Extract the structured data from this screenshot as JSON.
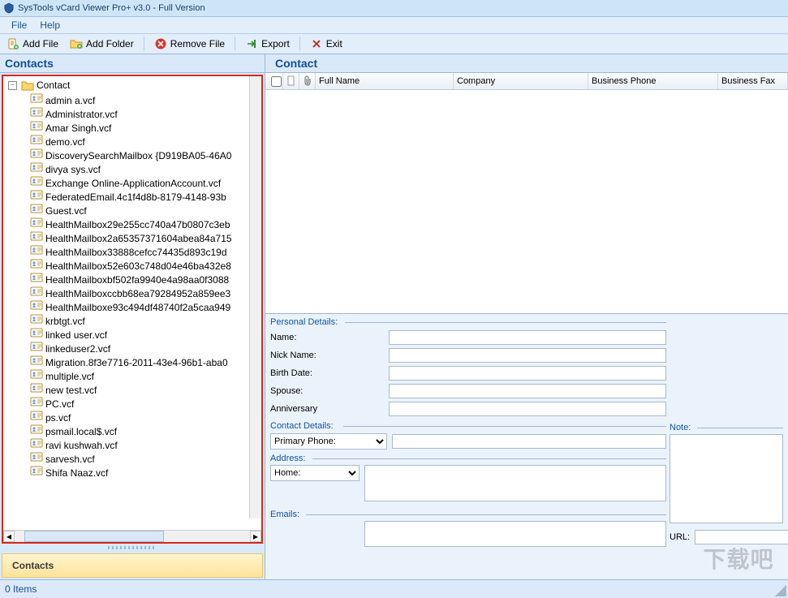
{
  "titlebar": {
    "text": "SysTools vCard Viewer Pro+ v3.0 - Full Version"
  },
  "menubar": {
    "file": "File",
    "help": "Help"
  },
  "toolbar": {
    "add_file": "Add File",
    "add_folder": "Add Folder",
    "remove_file": "Remove File",
    "export": "Export",
    "exit": "Exit"
  },
  "left": {
    "header": "Contacts",
    "root_label": "Contact",
    "items": [
      "admin a.vcf",
      "Administrator.vcf",
      "Amar Singh.vcf",
      "demo.vcf",
      "DiscoverySearchMailbox {D919BA05-46A0",
      "divya sys.vcf",
      "Exchange Online-ApplicationAccount.vcf",
      "FederatedEmail.4c1f4d8b-8179-4148-93b",
      "Guest.vcf",
      "HealthMailbox29e255cc740a47b0807c3eb",
      "HealthMailbox2a65357371604abea84a715",
      "HealthMailbox33888cefcc74435d893c19d",
      "HealthMailbox52e603c748d04e46ba432e8",
      "HealthMailboxbf502fa9940e4a98aa0f3088",
      "HealthMailboxccbb68ea79284952a859ee3",
      "HealthMailboxe93c494df48740f2a5caa949",
      "krbtgt.vcf",
      "linked user.vcf",
      "linkeduser2.vcf",
      "Migration.8f3e7716-2011-43e4-96b1-aba0",
      "multiple.vcf",
      "new test.vcf",
      "PC.vcf",
      "ps.vcf",
      "psmail.local$.vcf",
      "ravi kushwah.vcf",
      "sarvesh.vcf",
      "Shifa Naaz.vcf"
    ],
    "nav_label": "Contacts"
  },
  "right": {
    "header": "Contact",
    "columns": {
      "full_name": "Full Name",
      "company": "Company",
      "business_phone": "Business Phone",
      "business_fax": "Business Fax"
    }
  },
  "details": {
    "personal_legend": "Personal Details:",
    "name_lbl": "Name:",
    "nick_lbl": "Nick Name:",
    "birth_lbl": "Birth Date:",
    "spouse_lbl": "Spouse:",
    "anniv_lbl": "Anniversary",
    "contact_legend": "Contact Details:",
    "phone_selected": "Primary Phone:",
    "address_legend": "Address:",
    "address_selected": "Home:",
    "emails_legend": "Emails:",
    "note_legend": "Note:",
    "url_lbl": "URL:",
    "name_val": "",
    "nick_val": "",
    "birth_val": "",
    "spouse_val": "",
    "anniv_val": "",
    "phone_val": "",
    "address_val": "",
    "emails_val": "",
    "note_val": "",
    "url_val": ""
  },
  "statusbar": {
    "text": "0 Items"
  },
  "watermark": "下载吧"
}
